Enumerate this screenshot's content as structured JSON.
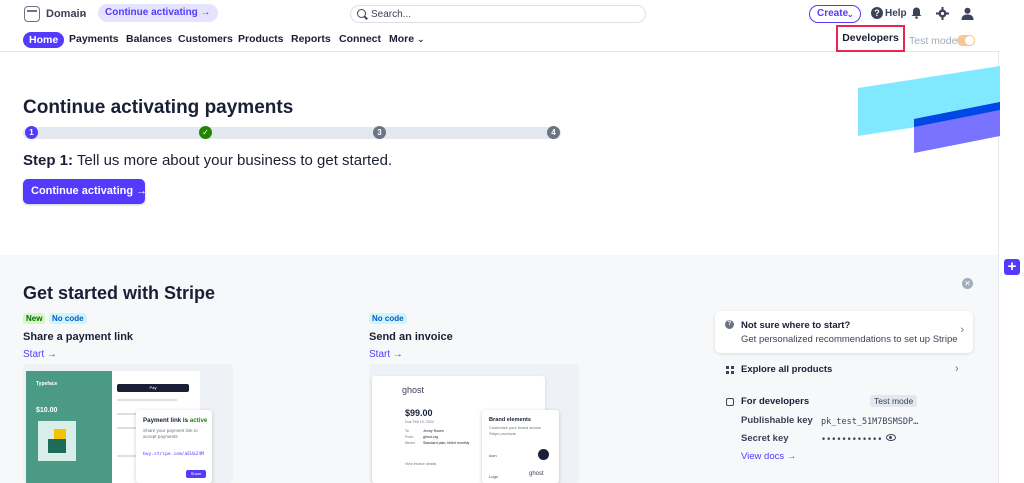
{
  "topbar": {
    "domain_label": "Domain",
    "activate_pill": "Continue activating →",
    "search_placeholder": "Search...",
    "create_label": "Create",
    "help_label": "Help"
  },
  "nav": {
    "items": [
      "Home",
      "Payments",
      "Balances",
      "Customers",
      "Products",
      "Reports",
      "Connect",
      "More"
    ],
    "developers": "Developers",
    "test_mode": "Test mode"
  },
  "hero": {
    "title": "Continue activating payments",
    "steps": [
      "1",
      "✓",
      "3",
      "4"
    ],
    "step_label": "Step 1:",
    "step_text": " Tell us more about your business to get started.",
    "button": "Continue activating →"
  },
  "get_started": {
    "title": "Get started with Stripe",
    "cards": [
      {
        "badges": [
          "New",
          "No code"
        ],
        "title": "Share a payment link",
        "link": "Start →",
        "preview": {
          "brand": "Typeface",
          "price": "$10.00",
          "pay_btn": "Pay",
          "popup_title": "Payment link is ",
          "popup_status": "active",
          "popup_desc": "Share your payment link to accept payments",
          "popup_url": "buy.stripe.com/aEUa24M",
          "share_btn": "Share"
        }
      },
      {
        "badges": [
          "No code"
        ],
        "title": "Send an invoice",
        "link": "Start →",
        "preview": {
          "brand": "ghost",
          "amount": "$99.00",
          "due": "Due Feb 10, 2024",
          "to_label": "To",
          "to_val": "Jenny Rosen",
          "from_label": "From",
          "from_val": "ghost.org",
          "memo_label": "Memo",
          "memo_val": "Standard plan, billed monthly",
          "view_link": "View invoice details",
          "brand_title": "Brand elements",
          "brand_desc": "Customize your brand across Stripe products",
          "icon_label": "Icon",
          "logo_label": "Logo"
        }
      }
    ],
    "side": {
      "prompt_title": "Not sure where to start?",
      "prompt_sub": "Get personalized recommendations to set up Stripe",
      "explore": "Explore all products",
      "dev_title": "For developers",
      "test_badge": "Test mode",
      "pub_label": "Publishable key",
      "pub_val": "pk_test_51M7BSMSDP…",
      "secret_label": "Secret key",
      "secret_val": "••••••••••••",
      "docs": "View docs →"
    }
  },
  "colors": {
    "accent": "#533afd",
    "highlight": "#e8264f",
    "step_done": "#228403",
    "step_idle": "#6b7385"
  },
  "icons": [
    "domain-icon",
    "search-icon",
    "chevron-down-icon",
    "help-icon",
    "bell-icon",
    "gear-icon",
    "user-icon",
    "check-icon",
    "close-icon",
    "question-icon",
    "grid-icon",
    "code-icon",
    "eye-icon",
    "plus-icon"
  ]
}
